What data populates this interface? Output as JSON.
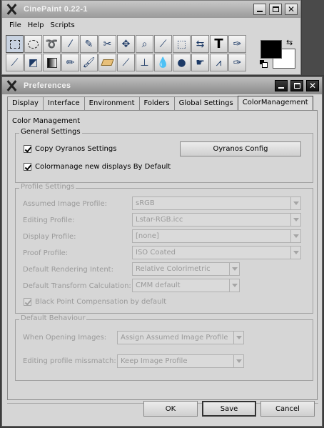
{
  "toolbox": {
    "title": "CinePaint 0.22-1",
    "menu": [
      "File",
      "Help",
      "Scripts"
    ],
    "tools_row1": [
      "rect-select-icon",
      "ellipse-select-icon",
      "lasso-icon",
      "magic-wand-icon",
      "bezier-icon",
      "scissors-icon",
      "move-icon",
      "magnify-icon",
      "crop-icon",
      "transform-icon",
      "flip-icon",
      "text-icon",
      "color-picker-icon"
    ],
    "tools_row2": [
      "eyedropper-icon",
      "bucket-fill-icon",
      "gradient-icon",
      "pencil-icon",
      "brush-icon",
      "eraser-icon",
      "airbrush-icon",
      "clone-icon",
      "blur-icon",
      "dodge-burn-icon",
      "smudge-icon",
      "measure-icon",
      "spline-icon"
    ],
    "foreground_color": "#000000",
    "background_color": "#ffffff"
  },
  "prefs": {
    "title": "Preferences",
    "tabs": [
      "Display",
      "Interface",
      "Environment",
      "Folders",
      "Global Settings",
      "ColorManagement"
    ],
    "active_tab": "ColorManagement",
    "section_heading": "Color Management",
    "general": {
      "title": "General Settings",
      "copy_oyranos": "Copy Oyranos Settings",
      "oyranos_config": "Oyranos Config",
      "colormanage_new": "Colormanage new displays By Default"
    },
    "profile": {
      "title": "Profile Settings",
      "assumed_image_label": "Assumed Image Profile:",
      "assumed_image_value": "sRGB",
      "editing_label": "Editing Profile:",
      "editing_value": "Lstar-RGB.icc",
      "display_label": "Display Profile:",
      "display_value": "[none]",
      "proof_label": "Proof Profile:",
      "proof_value": "ISO Coated",
      "rendering_label": "Default Rendering Intent:",
      "rendering_value": "Relative Colorimetric",
      "transform_label": "Default Transform Calculation:",
      "transform_value": "CMM default",
      "black_point": "Black Point Compensation by default"
    },
    "behaviour": {
      "title": "Default Behaviour",
      "opening_label": "When Opening Images:",
      "opening_value": "Assign Assumed Image Profile",
      "mismatch_label": "Editing profile missmatch:",
      "mismatch_value": "Keep Image Profile"
    },
    "buttons": {
      "ok": "OK",
      "save": "Save",
      "cancel": "Cancel"
    }
  }
}
